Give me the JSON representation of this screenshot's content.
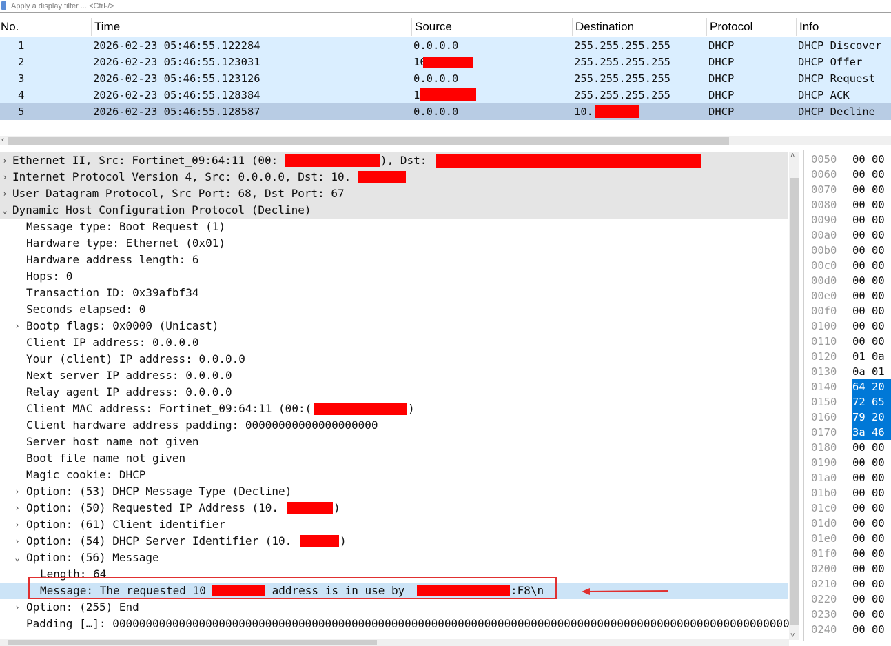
{
  "filter": {
    "placeholder": "Apply a display filter ... <Ctrl-/>"
  },
  "packet_list": {
    "columns": [
      "No.",
      "Time",
      "Source",
      "Destination",
      "Protocol",
      "Info"
    ],
    "rows": [
      {
        "no": "1",
        "time": "2026-02-23 05:46:55.122284",
        "src": "0.0.0.0",
        "dst": "255.255.255.255",
        "proto": "DHCP",
        "info": "DHCP Discover"
      },
      {
        "no": "2",
        "time": "2026-02-23 05:46:55.123031",
        "src": "10",
        "dst": "255.255.255.255",
        "proto": "DHCP",
        "info": "DHCP Offer"
      },
      {
        "no": "3",
        "time": "2026-02-23 05:46:55.123126",
        "src": "0.0.0.0",
        "dst": "255.255.255.255",
        "proto": "DHCP",
        "info": "DHCP Request"
      },
      {
        "no": "4",
        "time": "2026-02-23 05:46:55.128384",
        "src": "1",
        "dst": "255.255.255.255",
        "proto": "DHCP",
        "info": "DHCP ACK"
      },
      {
        "no": "5",
        "time": "2026-02-23 05:46:55.128587",
        "src": "0.0.0.0",
        "dst": "10.",
        "proto": "DHCP",
        "info": "DHCP Decline"
      }
    ]
  },
  "details": {
    "lines": [
      {
        "text": "Ethernet II, Src: Fortinet_09:64:11 (00:",
        "tail": "), Dst: ",
        "arrow": "›",
        "indent": 0
      },
      {
        "text": "Internet Protocol Version 4, Src: 0.0.0.0, Dst: 10.",
        "tail": "",
        "arrow": "›",
        "indent": 0
      },
      {
        "text": "User Datagram Protocol, Src Port: 68, Dst Port: 67",
        "tail": "",
        "arrow": "›",
        "indent": 0
      },
      {
        "text": "Dynamic Host Configuration Protocol (Decline)",
        "tail": "",
        "arrow": "⌄",
        "indent": 0
      },
      {
        "text": "Message type: Boot Request (1)",
        "tail": "",
        "arrow": "",
        "indent": 1
      },
      {
        "text": "Hardware type: Ethernet (0x01)",
        "tail": "",
        "arrow": "",
        "indent": 1
      },
      {
        "text": "Hardware address length: 6",
        "tail": "",
        "arrow": "",
        "indent": 1
      },
      {
        "text": "Hops: 0",
        "tail": "",
        "arrow": "",
        "indent": 1
      },
      {
        "text": "Transaction ID: 0x39afbf34",
        "tail": "",
        "arrow": "",
        "indent": 1
      },
      {
        "text": "Seconds elapsed: 0",
        "tail": "",
        "arrow": "",
        "indent": 1
      },
      {
        "text": "Bootp flags: 0x0000 (Unicast)",
        "tail": "",
        "arrow": "›",
        "indent": 1
      },
      {
        "text": "Client IP address: 0.0.0.0",
        "tail": "",
        "arrow": "",
        "indent": 1
      },
      {
        "text": "Your (client) IP address: 0.0.0.0",
        "tail": "",
        "arrow": "",
        "indent": 1
      },
      {
        "text": "Next server IP address: 0.0.0.0",
        "tail": "",
        "arrow": "",
        "indent": 1
      },
      {
        "text": "Relay agent IP address: 0.0.0.0",
        "tail": "",
        "arrow": "",
        "indent": 1
      },
      {
        "text": "Client MAC address: Fortinet_09:64:11 (00:(",
        "tail": ")",
        "arrow": "",
        "indent": 1
      },
      {
        "text": "Client hardware address padding: 00000000000000000000",
        "tail": "",
        "arrow": "",
        "indent": 1
      },
      {
        "text": "Server host name not given",
        "tail": "",
        "arrow": "",
        "indent": 1
      },
      {
        "text": "Boot file name not given",
        "tail": "",
        "arrow": "",
        "indent": 1
      },
      {
        "text": "Magic cookie: DHCP",
        "tail": "",
        "arrow": "",
        "indent": 1
      },
      {
        "text": "Option: (53) DHCP Message Type (Decline)",
        "tail": "",
        "arrow": "›",
        "indent": 1
      },
      {
        "text": "Option: (50) Requested IP Address (10.",
        "tail": ")",
        "arrow": "›",
        "indent": 1
      },
      {
        "text": "Option: (61) Client identifier",
        "tail": "",
        "arrow": "›",
        "indent": 1
      },
      {
        "text": "Option: (54) DHCP Server Identifier (10.",
        "tail": ")",
        "arrow": "›",
        "indent": 1
      },
      {
        "text": "Option: (56) Message",
        "tail": "",
        "arrow": "⌄",
        "indent": 1
      },
      {
        "text": "Length: 64",
        "tail": "",
        "arrow": "",
        "indent": 2
      },
      {
        "text": "Message: The requested 10",
        "mid": " address is in use by ",
        "tail": ":F8\\n",
        "arrow": "",
        "indent": 2
      },
      {
        "text": "Option: (255) End",
        "tail": "",
        "arrow": "›",
        "indent": 1
      },
      {
        "text": "Padding […]: 000000000000000000000000000000000000000000000000000000000000000000000000000000000000000000000000000000",
        "tail": "",
        "arrow": "",
        "indent": 1
      }
    ]
  },
  "hex": {
    "rows": [
      {
        "off": "0050",
        "bytes": "00 00"
      },
      {
        "off": "0060",
        "bytes": "00 00"
      },
      {
        "off": "0070",
        "bytes": "00 00"
      },
      {
        "off": "0080",
        "bytes": "00 00"
      },
      {
        "off": "0090",
        "bytes": "00 00"
      },
      {
        "off": "00a0",
        "bytes": "00 00"
      },
      {
        "off": "00b0",
        "bytes": "00 00"
      },
      {
        "off": "00c0",
        "bytes": "00 00"
      },
      {
        "off": "00d0",
        "bytes": "00 00"
      },
      {
        "off": "00e0",
        "bytes": "00 00"
      },
      {
        "off": "00f0",
        "bytes": "00 00"
      },
      {
        "off": "0100",
        "bytes": "00 00"
      },
      {
        "off": "0110",
        "bytes": "00 00"
      },
      {
        "off": "0120",
        "bytes": "01 0a"
      },
      {
        "off": "0130",
        "bytes": "0a 01"
      },
      {
        "off": "0140",
        "bytes": "64 20"
      },
      {
        "off": "0150",
        "bytes": "72 65"
      },
      {
        "off": "0160",
        "bytes": "79 20"
      },
      {
        "off": "0170",
        "bytes": "3a 46"
      },
      {
        "off": "0180",
        "bytes": "00 00"
      },
      {
        "off": "0190",
        "bytes": "00 00"
      },
      {
        "off": "01a0",
        "bytes": "00 00"
      },
      {
        "off": "01b0",
        "bytes": "00 00"
      },
      {
        "off": "01c0",
        "bytes": "00 00"
      },
      {
        "off": "01d0",
        "bytes": "00 00"
      },
      {
        "off": "01e0",
        "bytes": "00 00"
      },
      {
        "off": "01f0",
        "bytes": "00 00"
      },
      {
        "off": "0200",
        "bytes": "00 00"
      },
      {
        "off": "0210",
        "bytes": "00 00"
      },
      {
        "off": "0220",
        "bytes": "00 00"
      },
      {
        "off": "0230",
        "bytes": "00 00"
      },
      {
        "off": "0240",
        "bytes": "00 00"
      }
    ],
    "selected_color": "#0078d7"
  },
  "colors": {
    "row_bg": "#daeeff",
    "row_selected": "#b8cce4",
    "redaction": "#ff0000",
    "annotation": "#e03030"
  }
}
